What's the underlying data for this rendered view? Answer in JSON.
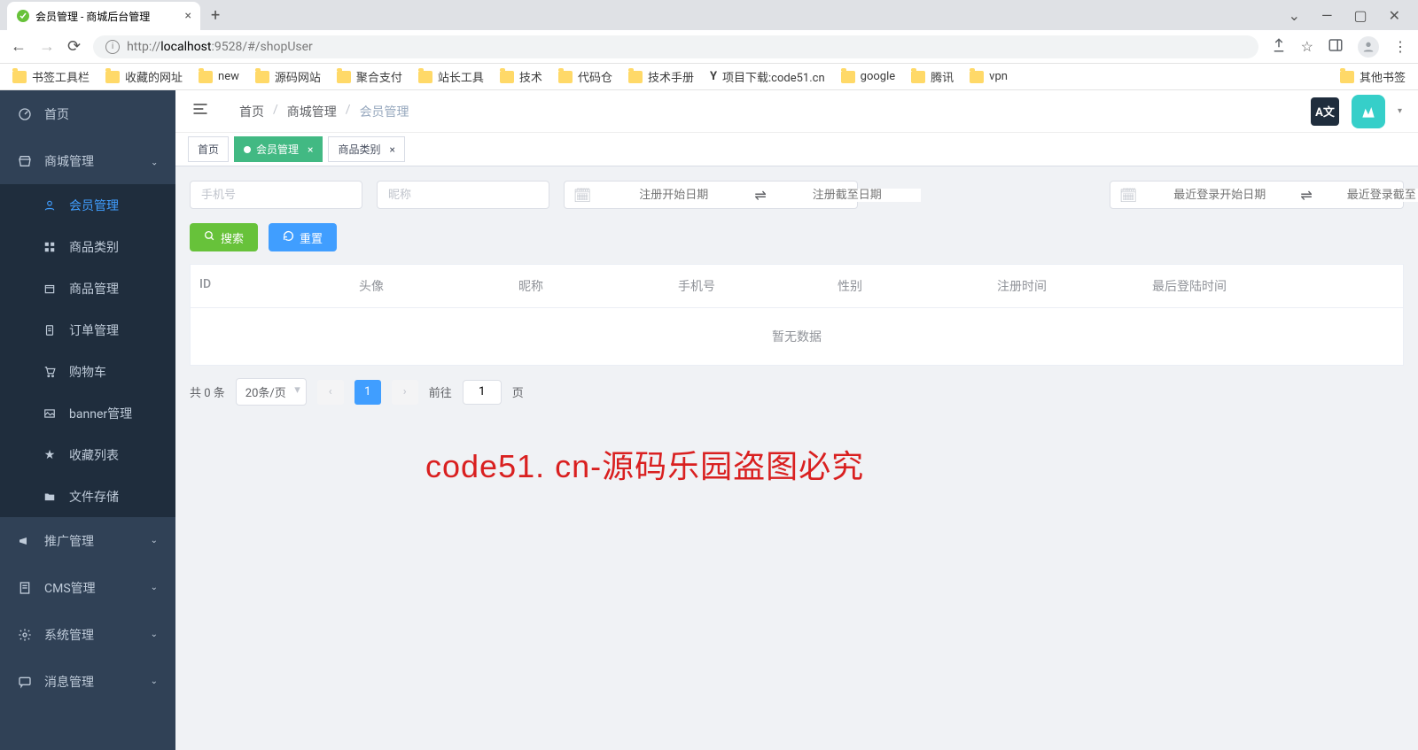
{
  "browser": {
    "tab_title": "会员管理 - 商城后台管理",
    "url_prefix": "http://",
    "url_host": "localhost",
    "url_rest": ":9528/#/shopUser",
    "new_tab": "+",
    "win_min": "—",
    "win_max": "▢",
    "win_close": "✕"
  },
  "bookmarks": [
    "书签工具栏",
    "收藏的网址",
    "new",
    "源码网站",
    "聚合支付",
    "站长工具",
    "技术",
    "代码仓",
    "技术手册",
    "项目下载:code51.cn",
    "google",
    "腾讯",
    "vpn"
  ],
  "bookmarks_other": "其他书签",
  "sidebar": {
    "home": "首页",
    "mall": "商城管理",
    "mall_items": [
      "会员管理",
      "商品类别",
      "商品管理",
      "订单管理",
      "购物车",
      "banner管理",
      "收藏列表",
      "文件存储"
    ],
    "promo": "推广管理",
    "cms": "CMS管理",
    "system": "系统管理",
    "message": "消息管理"
  },
  "breadcrumb": {
    "a": "首页",
    "b": "商城管理",
    "c": "会员管理"
  },
  "header": {
    "lang": "A文"
  },
  "page_tabs": [
    {
      "label": "首页",
      "active": false,
      "closable": false
    },
    {
      "label": "会员管理",
      "active": true,
      "closable": true
    },
    {
      "label": "商品类别",
      "active": false,
      "closable": true
    }
  ],
  "filters": {
    "phone_ph": "手机号",
    "nick_ph": "昵称",
    "reg_start_ph": "注册开始日期",
    "reg_end_ph": "注册截至日期",
    "login_start_ph": "最近登录开始日期",
    "login_end_ph": "最近登录截至日期",
    "range_sep_icon": "⇌"
  },
  "buttons": {
    "search": "搜索",
    "reset": "重置"
  },
  "table": {
    "cols": [
      "ID",
      "头像",
      "昵称",
      "手机号",
      "性别",
      "注册时间",
      "最后登陆时间"
    ],
    "col_widths": [
      "180px",
      "180px",
      "180px",
      "180px",
      "180px",
      "175px",
      "175px"
    ],
    "empty": "暂无数据"
  },
  "pagination": {
    "total": "共 0 条",
    "page_size": "20条/页",
    "current": "1",
    "goto_label": "前往",
    "goto_value": "1",
    "goto_suffix": "页"
  },
  "watermark": "code51. cn-源码乐园盗图必究"
}
